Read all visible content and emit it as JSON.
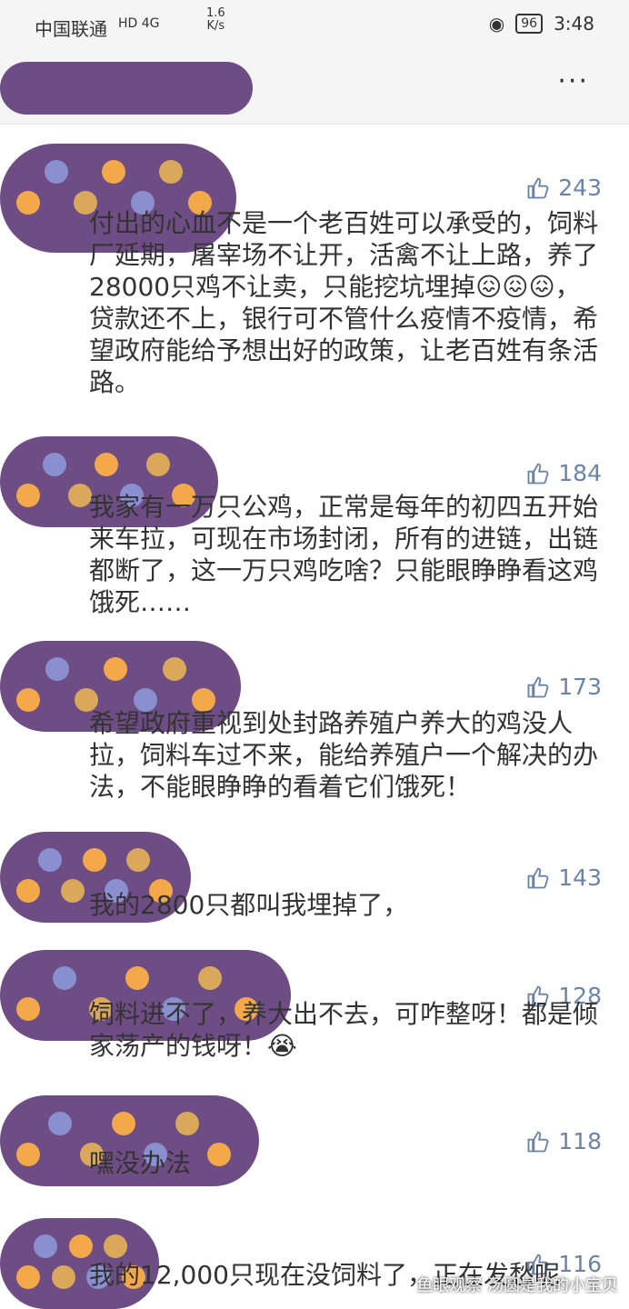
{
  "status_bar": {
    "carrier": "中国联通",
    "network": "HD 4G",
    "speed_value": "1.6",
    "speed_unit": "K/s",
    "battery": "96",
    "time": "3:48"
  },
  "header": {
    "more_label": "···"
  },
  "comments": [
    {
      "likes": "243",
      "text": "付出的心血不是一个老百姓可以承受的，饲料厂延期，屠宰场不让开，活禽不让上路，养了28000只鸡不让卖，只能挖坑埋掉😖😖😖，贷款还不上，银行可不管什么疫情不疫情，希望政府能给予想出好的政策，让老百姓有条活路。"
    },
    {
      "likes": "184",
      "text": "我家有一万只公鸡，正常是每年的初四五开始来车拉，可现在市场封闭，所有的进链，出链都断了，这一万只鸡吃啥？只能眼睁睁看这鸡饿死……"
    },
    {
      "likes": "173",
      "text": "希望政府重视到处封路养殖户养大的鸡没人拉，饲料车过不来，能给养殖户一个解决的办法，不能眼睁睁的看着它们饿死！"
    },
    {
      "likes": "143",
      "text": "我的2800只都叫我埋掉了，"
    },
    {
      "likes": "128",
      "text": "饲料进不了，养大出不去，可咋整呀！都是倾家荡产的钱呀！😭"
    },
    {
      "likes": "118",
      "text": "嘿没办法"
    },
    {
      "likes": "116",
      "text": "我的12,000只现在没饲料了，正在发愁呢"
    }
  ],
  "watermark": "鱼眼观察 汤圆是我的小宝贝"
}
